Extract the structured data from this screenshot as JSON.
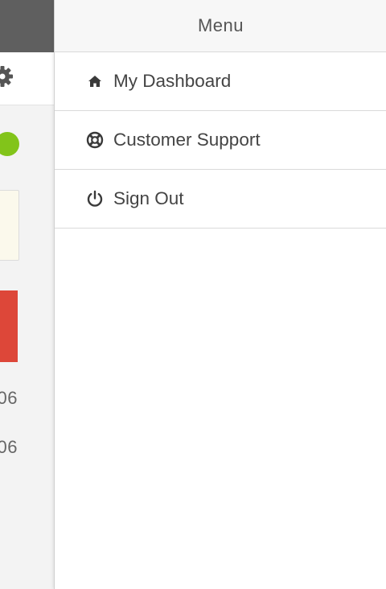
{
  "menu": {
    "title": "Menu",
    "items": [
      {
        "label": "My Dashboard",
        "icon": "home-icon"
      },
      {
        "label": "Customer Support",
        "icon": "lifebuoy-icon"
      },
      {
        "label": "Sign Out",
        "icon": "power-icon"
      }
    ]
  },
  "background_app": {
    "values": [
      "06",
      "06"
    ],
    "colors": {
      "topbar": "#5f5f5f",
      "status_dot": "#82c41a",
      "alert_card": "#dd4739",
      "note_card": "#fbf9ec"
    }
  }
}
